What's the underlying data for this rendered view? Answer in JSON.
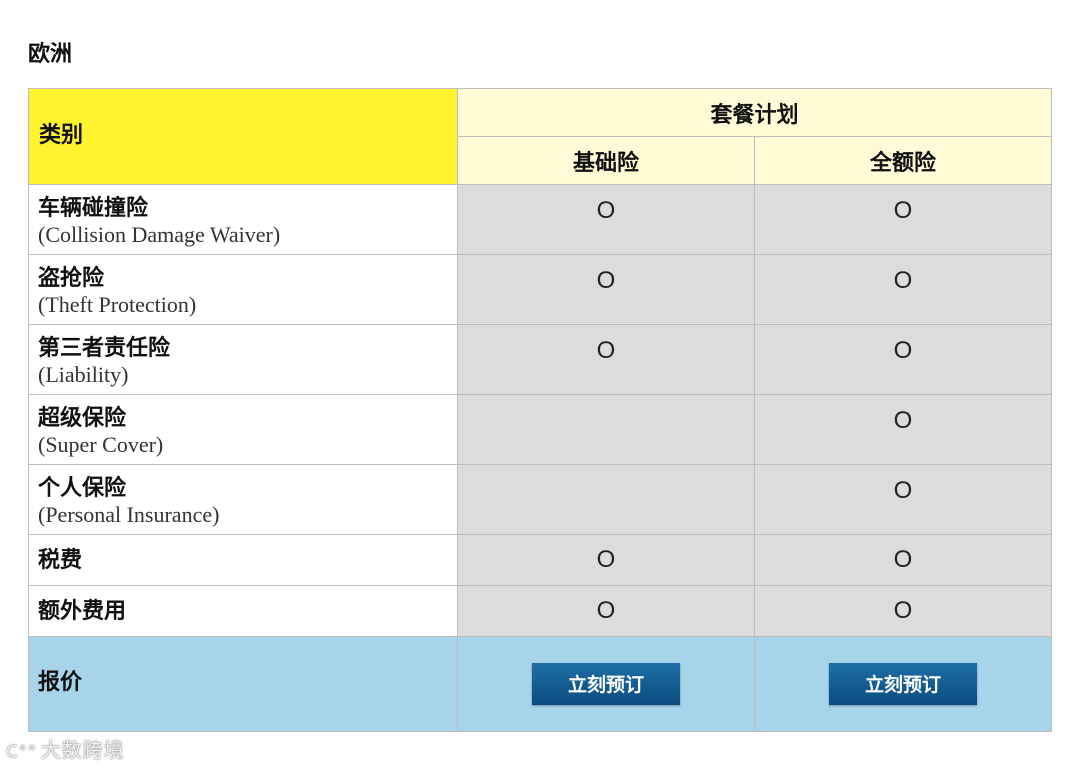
{
  "region_title": "欧洲",
  "table": {
    "category_header": "类别",
    "plan_header": "套餐计划",
    "plans": [
      "基础险",
      "全额险"
    ],
    "rows": [
      {
        "zh": "车辆碰撞险",
        "en": "(Collision Damage Waiver)",
        "basic": "O",
        "full": "O"
      },
      {
        "zh": "盗抢险",
        "en": "(Theft Protection)",
        "basic": "O",
        "full": "O"
      },
      {
        "zh": "第三者责任险",
        "en": "(Liability)",
        "basic": "O",
        "full": "O"
      },
      {
        "zh": "超级保险",
        "en": "(Super Cover)",
        "basic": "",
        "full": "O"
      },
      {
        "zh": "个人保险",
        "en": "(Personal Insurance)",
        "basic": "",
        "full": "O"
      },
      {
        "zh": "税费",
        "en": "",
        "basic": "O",
        "full": "O"
      },
      {
        "zh": "额外费用",
        "en": "",
        "basic": "O",
        "full": "O"
      }
    ],
    "price_label": "报价",
    "book_button_label": "立刻预订"
  },
  "watermark": {
    "text": "大数跨境"
  },
  "colors": {
    "category_header_bg": "#fff22e",
    "plan_header_bg": "#fffbd6",
    "mark_cell_bg": "#dcdcdc",
    "price_row_bg": "#a8d4ea",
    "button_bg": "#0b4c7e"
  }
}
